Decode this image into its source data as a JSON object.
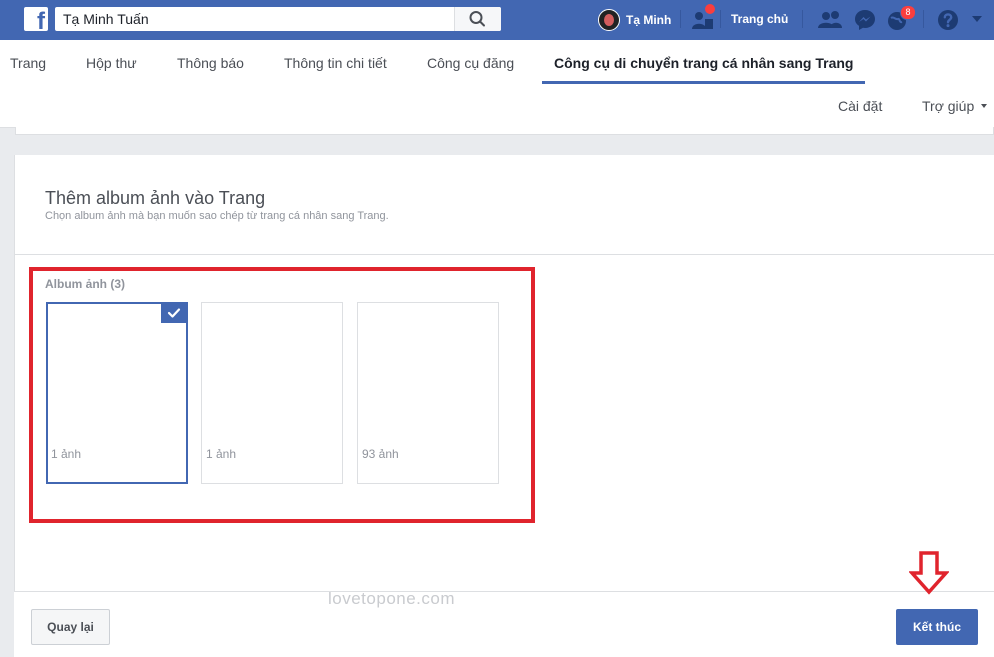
{
  "topbar": {
    "logo_icon": "facebook-logo-icon",
    "search_value": "Tạ Minh Tuấn",
    "search_icon": "search-icon",
    "user_name": "Tạ Minh",
    "home_label": "Trang chủ",
    "notifications_count": "8",
    "icons": [
      "friend-requests-icon",
      "messenger-icon",
      "globe-icon",
      "help-icon",
      "caret-down-icon"
    ]
  },
  "nav": {
    "tabs": [
      {
        "label": "Trang"
      },
      {
        "label": "Hộp thư"
      },
      {
        "label": "Thông báo"
      },
      {
        "label": "Thông tin chi tiết"
      },
      {
        "label": "Công cụ đăng"
      },
      {
        "label": "Công cụ di chuyển trang cá nhân sang Trang",
        "active": true
      }
    ],
    "settings_label": "Cài đặt",
    "help_label": "Trợ giúp"
  },
  "panel": {
    "title": "Thêm album ảnh vào Trang",
    "subtitle": "Chọn album ảnh mà bạn muốn sao chép từ trang cá nhân sang Trang."
  },
  "albums": {
    "heading": "Album ảnh (3)",
    "items": [
      {
        "count": "1 ảnh",
        "selected": true
      },
      {
        "count": "1 ảnh",
        "selected": false
      },
      {
        "count": "93 ảnh",
        "selected": false
      }
    ]
  },
  "footer": {
    "back_label": "Quay lại",
    "finish_label": "Kết thúc"
  },
  "watermark": "lovetopone.com",
  "colors": {
    "brand": "#4267b2",
    "highlight": "#e0242d",
    "badge": "#fa3e3e"
  }
}
